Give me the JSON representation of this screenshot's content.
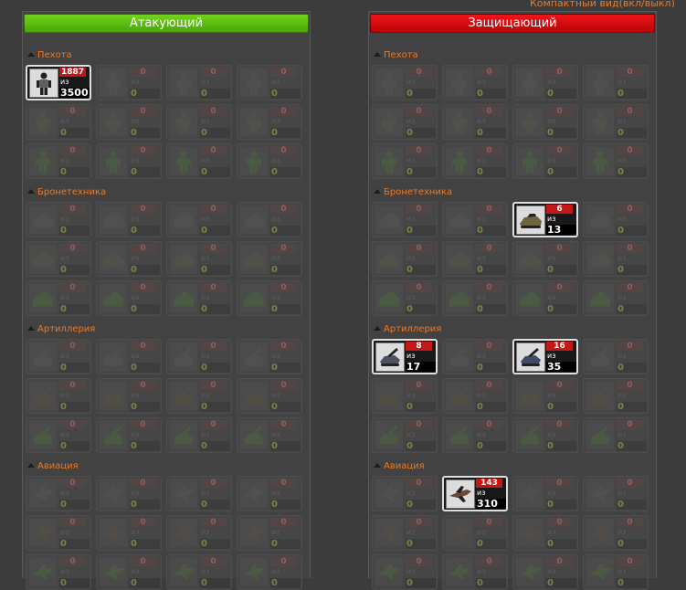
{
  "toggle_label": "Компактный вид(вкл/выкл)",
  "panels": [
    {
      "title": "Атакующий",
      "color": "#5cbe12",
      "sections": [
        {
          "title": "Пехота",
          "kind": "infantry",
          "units": [
            {
              "count": "1887",
              "of": "из",
              "total": "3500",
              "active": true,
              "tint": "#5e5e5e"
            },
            {
              "count": "0",
              "of": "из",
              "total": "0",
              "tint": "#5a5a5a"
            },
            {
              "count": "0",
              "of": "из",
              "total": "0",
              "tint": "#5a5a5a"
            },
            {
              "count": "0",
              "of": "из",
              "total": "0",
              "tint": "#5a5a5a"
            },
            {
              "count": "0",
              "of": "из",
              "total": "0",
              "tint": "#5b5a52"
            },
            {
              "count": "0",
              "of": "из",
              "total": "0",
              "tint": "#5b5a52"
            },
            {
              "count": "0",
              "of": "из",
              "total": "0",
              "tint": "#5b5a52"
            },
            {
              "count": "0",
              "of": "из",
              "total": "0",
              "tint": "#5b5a52"
            },
            {
              "count": "0",
              "of": "из",
              "total": "0",
              "tint": "#506a44"
            },
            {
              "count": "0",
              "of": "из",
              "total": "0",
              "tint": "#506a44"
            },
            {
              "count": "0",
              "of": "из",
              "total": "0",
              "tint": "#506a44"
            },
            {
              "count": "0",
              "of": "из",
              "total": "0",
              "tint": "#506a44"
            }
          ]
        },
        {
          "title": "Бронетехника",
          "kind": "vehicle",
          "units": [
            {
              "count": "0",
              "of": "из",
              "total": "0",
              "tint": "#5a5a5a"
            },
            {
              "count": "0",
              "of": "из",
              "total": "0",
              "tint": "#5a5a5a"
            },
            {
              "count": "0",
              "of": "из",
              "total": "0",
              "tint": "#5a5a5a"
            },
            {
              "count": "0",
              "of": "из",
              "total": "0",
              "tint": "#5a5a5a"
            },
            {
              "count": "0",
              "of": "из",
              "total": "0",
              "tint": "#5b5a52"
            },
            {
              "count": "0",
              "of": "из",
              "total": "0",
              "tint": "#5b5a52"
            },
            {
              "count": "0",
              "of": "из",
              "total": "0",
              "tint": "#5b5a52"
            },
            {
              "count": "0",
              "of": "из",
              "total": "0",
              "tint": "#5b5a52"
            },
            {
              "count": "0",
              "of": "из",
              "total": "0",
              "tint": "#506a44"
            },
            {
              "count": "0",
              "of": "из",
              "total": "0",
              "tint": "#506a44"
            },
            {
              "count": "0",
              "of": "из",
              "total": "0",
              "tint": "#506a44"
            },
            {
              "count": "0",
              "of": "из",
              "total": "0",
              "tint": "#506a44"
            }
          ]
        },
        {
          "title": "Артиллерия",
          "kind": "artillery",
          "units": [
            {
              "count": "0",
              "of": "из",
              "total": "0",
              "tint": "#5a5a5a"
            },
            {
              "count": "0",
              "of": "из",
              "total": "0",
              "tint": "#5a5a5a"
            },
            {
              "count": "0",
              "of": "из",
              "total": "0",
              "tint": "#5a5a5a"
            },
            {
              "count": "0",
              "of": "из",
              "total": "0",
              "tint": "#5a5a5a"
            },
            {
              "count": "0",
              "of": "из",
              "total": "0",
              "tint": "#5e5548"
            },
            {
              "count": "0",
              "of": "из",
              "total": "0",
              "tint": "#5e5548"
            },
            {
              "count": "0",
              "of": "из",
              "total": "0",
              "tint": "#5e5548"
            },
            {
              "count": "0",
              "of": "из",
              "total": "0",
              "tint": "#5e5548"
            },
            {
              "count": "0",
              "of": "из",
              "total": "0",
              "tint": "#506a44"
            },
            {
              "count": "0",
              "of": "из",
              "total": "0",
              "tint": "#506a44"
            },
            {
              "count": "0",
              "of": "из",
              "total": "0",
              "tint": "#506a44"
            },
            {
              "count": "0",
              "of": "из",
              "total": "0",
              "tint": "#506a44"
            }
          ]
        },
        {
          "title": "Авиация",
          "kind": "aircraft",
          "units": [
            {
              "count": "0",
              "of": "из",
              "total": "0",
              "tint": "#5a5a5a"
            },
            {
              "count": "0",
              "of": "из",
              "total": "0",
              "tint": "#5a5a5a"
            },
            {
              "count": "0",
              "of": "из",
              "total": "0",
              "tint": "#5a5a5a"
            },
            {
              "count": "0",
              "of": "из",
              "total": "0",
              "tint": "#5a5a5a"
            },
            {
              "count": "0",
              "of": "из",
              "total": "0",
              "tint": "#5e5548"
            },
            {
              "count": "0",
              "of": "из",
              "total": "0",
              "tint": "#5e5548"
            },
            {
              "count": "0",
              "of": "из",
              "total": "0",
              "tint": "#5e5548"
            },
            {
              "count": "0",
              "of": "из",
              "total": "0",
              "tint": "#5e5548"
            },
            {
              "count": "0",
              "of": "из",
              "total": "0",
              "tint": "#506a44"
            },
            {
              "count": "0",
              "of": "из",
              "total": "0",
              "tint": "#506a44"
            },
            {
              "count": "0",
              "of": "из",
              "total": "0",
              "tint": "#506a44"
            },
            {
              "count": "0",
              "of": "из",
              "total": "0",
              "tint": "#506a44"
            }
          ]
        }
      ]
    },
    {
      "title": "Защищающий",
      "color": "#d80c10",
      "sections": [
        {
          "title": "Пехота",
          "kind": "infantry",
          "units": [
            {
              "count": "0",
              "of": "из",
              "total": "0",
              "tint": "#5a5a5a"
            },
            {
              "count": "0",
              "of": "из",
              "total": "0",
              "tint": "#5a5a5a"
            },
            {
              "count": "0",
              "of": "из",
              "total": "0",
              "tint": "#5a5a5a"
            },
            {
              "count": "0",
              "of": "из",
              "total": "0",
              "tint": "#5a5a5a"
            },
            {
              "count": "0",
              "of": "из",
              "total": "0",
              "tint": "#5b5a52"
            },
            {
              "count": "0",
              "of": "из",
              "total": "0",
              "tint": "#5b5a52"
            },
            {
              "count": "0",
              "of": "из",
              "total": "0",
              "tint": "#5b5a52"
            },
            {
              "count": "0",
              "of": "из",
              "total": "0",
              "tint": "#5b5a52"
            },
            {
              "count": "0",
              "of": "из",
              "total": "0",
              "tint": "#506a44"
            },
            {
              "count": "0",
              "of": "из",
              "total": "0",
              "tint": "#506a44"
            },
            {
              "count": "0",
              "of": "из",
              "total": "0",
              "tint": "#506a44"
            },
            {
              "count": "0",
              "of": "из",
              "total": "0",
              "tint": "#506a44"
            }
          ]
        },
        {
          "title": "Бронетехника",
          "kind": "vehicle",
          "units": [
            {
              "count": "0",
              "of": "из",
              "total": "0",
              "tint": "#5a5a5a"
            },
            {
              "count": "0",
              "of": "из",
              "total": "0",
              "tint": "#5a5a5a"
            },
            {
              "count": "6",
              "of": "из",
              "total": "13",
              "active": true,
              "tint": "#6d6540"
            },
            {
              "count": "0",
              "of": "из",
              "total": "0",
              "tint": "#5a5a5a"
            },
            {
              "count": "0",
              "of": "из",
              "total": "0",
              "tint": "#5b5a52"
            },
            {
              "count": "0",
              "of": "из",
              "total": "0",
              "tint": "#5b5a52"
            },
            {
              "count": "0",
              "of": "из",
              "total": "0",
              "tint": "#5b5a52"
            },
            {
              "count": "0",
              "of": "из",
              "total": "0",
              "tint": "#5b5a52"
            },
            {
              "count": "0",
              "of": "из",
              "total": "0",
              "tint": "#506a44"
            },
            {
              "count": "0",
              "of": "из",
              "total": "0",
              "tint": "#506a44"
            },
            {
              "count": "0",
              "of": "из",
              "total": "0",
              "tint": "#506a44"
            },
            {
              "count": "0",
              "of": "из",
              "total": "0",
              "tint": "#506a44"
            }
          ]
        },
        {
          "title": "Артиллерия",
          "kind": "artillery",
          "units": [
            {
              "count": "8",
              "of": "из",
              "total": "17",
              "active": true,
              "tint": "#4c5260"
            },
            {
              "count": "0",
              "of": "из",
              "total": "0",
              "tint": "#5a5a5a"
            },
            {
              "count": "16",
              "of": "из",
              "total": "35",
              "active": true,
              "tint": "#3e4c68"
            },
            {
              "count": "0",
              "of": "из",
              "total": "0",
              "tint": "#5a5a5a"
            },
            {
              "count": "0",
              "of": "из",
              "total": "0",
              "tint": "#5e5548"
            },
            {
              "count": "0",
              "of": "из",
              "total": "0",
              "tint": "#5e5548"
            },
            {
              "count": "0",
              "of": "из",
              "total": "0",
              "tint": "#5e5548"
            },
            {
              "count": "0",
              "of": "из",
              "total": "0",
              "tint": "#5e5548"
            },
            {
              "count": "0",
              "of": "из",
              "total": "0",
              "tint": "#506a44"
            },
            {
              "count": "0",
              "of": "из",
              "total": "0",
              "tint": "#506a44"
            },
            {
              "count": "0",
              "of": "из",
              "total": "0",
              "tint": "#506a44"
            },
            {
              "count": "0",
              "of": "из",
              "total": "0",
              "tint": "#506a44"
            }
          ]
        },
        {
          "title": "Авиация",
          "kind": "aircraft",
          "units": [
            {
              "count": "0",
              "of": "из",
              "total": "0",
              "tint": "#5a5a5a"
            },
            {
              "count": "143",
              "of": "из",
              "total": "310",
              "active": true,
              "tint": "#6a4838"
            },
            {
              "count": "0",
              "of": "из",
              "total": "0",
              "tint": "#5a5a5a"
            },
            {
              "count": "0",
              "of": "из",
              "total": "0",
              "tint": "#5a5a5a"
            },
            {
              "count": "0",
              "of": "из",
              "total": "0",
              "tint": "#5e5548"
            },
            {
              "count": "0",
              "of": "из",
              "total": "0",
              "tint": "#5e5548"
            },
            {
              "count": "0",
              "of": "из",
              "total": "0",
              "tint": "#5e5548"
            },
            {
              "count": "0",
              "of": "из",
              "total": "0",
              "tint": "#5e5548"
            },
            {
              "count": "0",
              "of": "из",
              "total": "0",
              "tint": "#506a44"
            },
            {
              "count": "0",
              "of": "из",
              "total": "0",
              "tint": "#506a44"
            },
            {
              "count": "0",
              "of": "из",
              "total": "0",
              "tint": "#506a44"
            },
            {
              "count": "0",
              "of": "из",
              "total": "0",
              "tint": "#506a44"
            }
          ]
        }
      ]
    }
  ]
}
